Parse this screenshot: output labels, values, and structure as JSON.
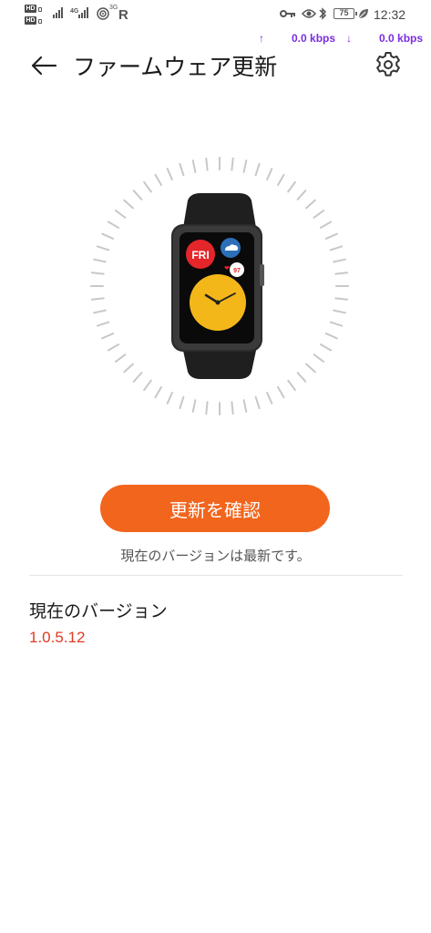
{
  "status_bar": {
    "hd1": "HD",
    "hd2": "HD",
    "net_type": "4G",
    "net_small": "3G",
    "roaming": "R",
    "battery": "75",
    "time": "12:32",
    "upload_arrow": "↑",
    "upload_speed": "0.0 kbps",
    "download_arrow": "↓",
    "download_speed": "0.0 kbps",
    "speed_color": "#7a2ee0"
  },
  "header": {
    "back_icon": "back-arrow-icon",
    "title": "ファームウェア更新",
    "settings_icon": "gear-icon"
  },
  "watch": {
    "day_label": "FRI",
    "heart_value": "97"
  },
  "update": {
    "button_label": "更新を確認",
    "status": "現在のバージョンは最新です。",
    "accent_color": "#f2651d"
  },
  "current_version": {
    "heading": "現在のバージョン",
    "value": "1.0.5.12",
    "value_color": "#e03a22"
  }
}
